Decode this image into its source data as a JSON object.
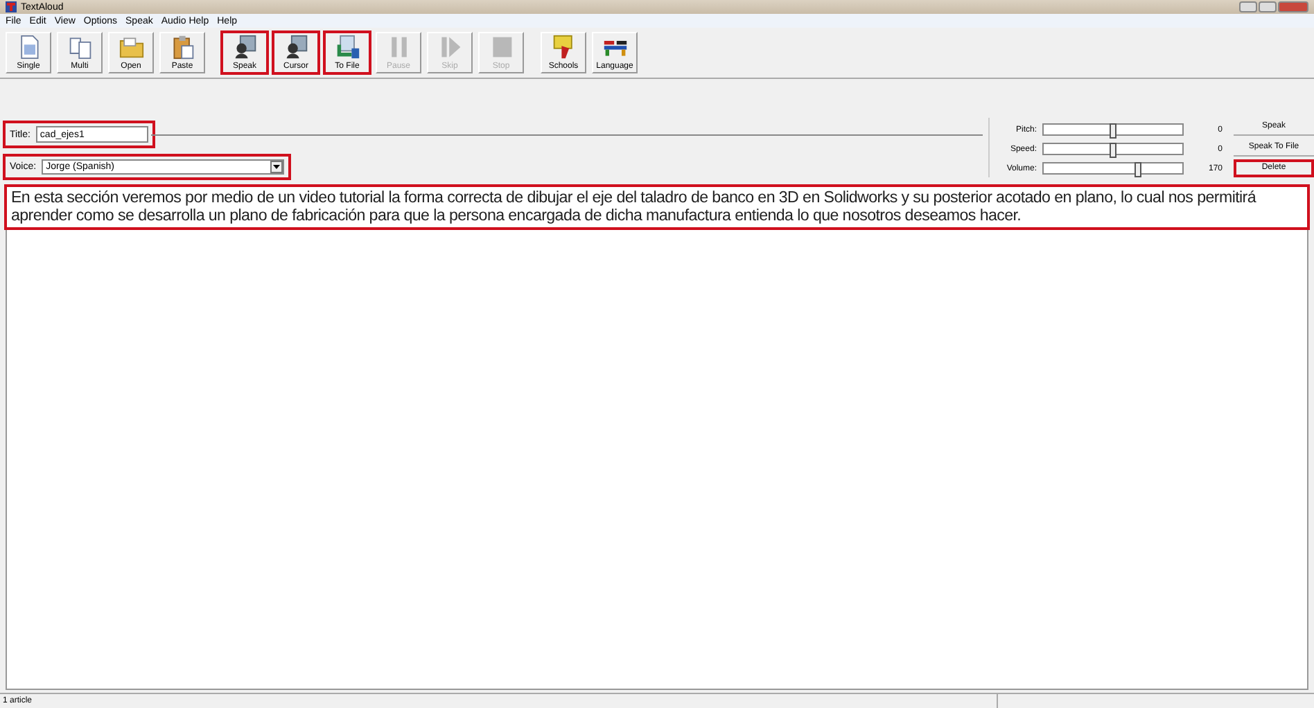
{
  "window": {
    "title": "TextAloud"
  },
  "menu": [
    "File",
    "Edit",
    "View",
    "Options",
    "Speak",
    "Audio Help",
    "Help"
  ],
  "toolbar": [
    {
      "label": "Single",
      "kind": "page",
      "disabled": false,
      "highlighted": false
    },
    {
      "label": "Multi",
      "kind": "pages",
      "disabled": false,
      "highlighted": false
    },
    {
      "label": "Open",
      "kind": "folder",
      "disabled": false,
      "highlighted": false
    },
    {
      "label": "Paste",
      "kind": "clipboard",
      "disabled": false,
      "highlighted": false
    },
    {
      "label": "Speak",
      "kind": "speaker",
      "disabled": false,
      "highlighted": true
    },
    {
      "label": "Cursor",
      "kind": "speaker",
      "disabled": false,
      "highlighted": true
    },
    {
      "label": "To File",
      "kind": "tofile",
      "disabled": false,
      "highlighted": true
    },
    {
      "label": "Pause",
      "kind": "pause",
      "disabled": true,
      "highlighted": false
    },
    {
      "label": "Skip",
      "kind": "skip",
      "disabled": true,
      "highlighted": false
    },
    {
      "label": "Stop",
      "kind": "stop",
      "disabled": true,
      "highlighted": false
    },
    {
      "label": "Schools",
      "kind": "school",
      "disabled": false,
      "highlighted": false
    },
    {
      "label": "Language",
      "kind": "flags",
      "disabled": false,
      "highlighted": false
    }
  ],
  "title_field": {
    "label": "Title:",
    "value": "cad_ejes1",
    "highlighted": true
  },
  "voice_field": {
    "label": "Voice:",
    "value": "Jorge (Spanish)",
    "highlighted": true
  },
  "sliders": [
    {
      "label": "Pitch:",
      "level": 0.5,
      "reading": "0"
    },
    {
      "label": "Speed:",
      "level": 0.5,
      "reading": "0"
    },
    {
      "label": "Volume:",
      "level": 0.68,
      "reading": "170"
    }
  ],
  "side_buttons": [
    {
      "label": "Speak",
      "highlighted": false
    },
    {
      "label": "Speak To File",
      "highlighted": false
    },
    {
      "label": "Delete",
      "highlighted": true
    }
  ],
  "document": {
    "text": "En esta sección veremos por medio de un video tutorial la forma correcta de dibujar el eje del taladro de banco en 3D en Solidworks y su posterior acotado en plano, lo cual nos permitirá aprender como se desarrolla un plano de fabricación para que la persona encargada de dicha manufactura entienda lo que nosotros deseamos hacer.",
    "highlighted": true
  },
  "status_bar": {
    "text": "1 article"
  }
}
